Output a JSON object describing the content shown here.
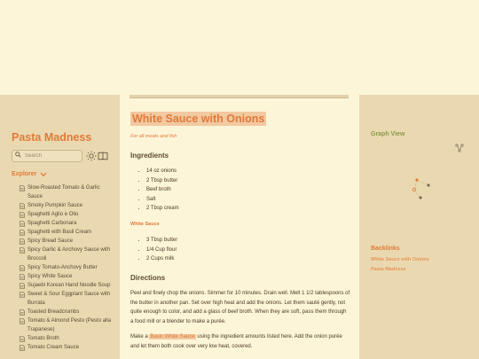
{
  "sidebar": {
    "site_title": "Pasta Madness",
    "search_placeholder": "Search",
    "explorer_label": "Explorer",
    "files": [
      "Slow-Roasted Tomato & Garlic Sauce",
      "Smoky Pumpkin Sauce",
      "Spaghetti Aglio e Olio",
      "Spaghetti Carbonara",
      "Spaghetti with Basil Cream",
      "Spicy Bread Sauce",
      "Spicy Garlic & Anchovy Sauce with Broccoli",
      "Spicy Tomato-Anchovy Butter",
      "Spicy White Sauce",
      "Sujaebi Korean Hand Noodle Soup",
      "Sweet & Sour Eggplant Sauce with Burrata",
      "Toasted Breadcrumbs",
      "Tomato & Almond Pesto (Pesto alla Trapanese)",
      "Tomato Broth",
      "Tomato Cream Sauce"
    ]
  },
  "note": {
    "title": "White Sauce with Onions",
    "subtitle": "For all meats and fish",
    "ingredients_heading": "Ingredients",
    "ingredients": [
      "14 oz onions",
      "2 Tbsp butter",
      "Beef broth",
      "Salt",
      "2 Tbsp cream"
    ],
    "white_sauce_heading": "White Sauce",
    "white_sauce_items": [
      "3 Tbsp butter",
      "1/4 Cup flour",
      "2 Cups milk"
    ],
    "directions_heading": "Directions",
    "directions_p1": "Peel and finely chop the onions. Simmer for 10 minutes. Drain well. Melt 1 1/2 tablespoons of the butter in another pan. Set over high heat and add the onions. Let them sauté gently, not quite enough to color, and add a glass of beef broth. When they are soft, pass them through a food mill or a blender to make a purée.",
    "directions_p2_before": "Make a ",
    "directions_p2_link": "Basic White Sauce",
    "directions_p2_after": " using the ingredient amounts listed here. Add the onion purée and let them both cook over very low heat, covered."
  },
  "right": {
    "graph_title": "Graph View",
    "backlinks_title": "Backlinks",
    "backlinks": [
      "White Sauce with Onions",
      "Pasta Madness"
    ]
  },
  "colors": {
    "accent": "#e07a3a",
    "highlight": "#f2c9a1",
    "panel": "#ead9b0",
    "background": "#fdf5d8",
    "graph_title": "#8a9a4a"
  },
  "icons": {
    "search": "search-icon",
    "theme": "sun-icon",
    "reader": "book-icon",
    "explorer_toggle": "chevron-down-icon",
    "file": "file-icon",
    "graph_expand": "graph-expand-icon"
  }
}
